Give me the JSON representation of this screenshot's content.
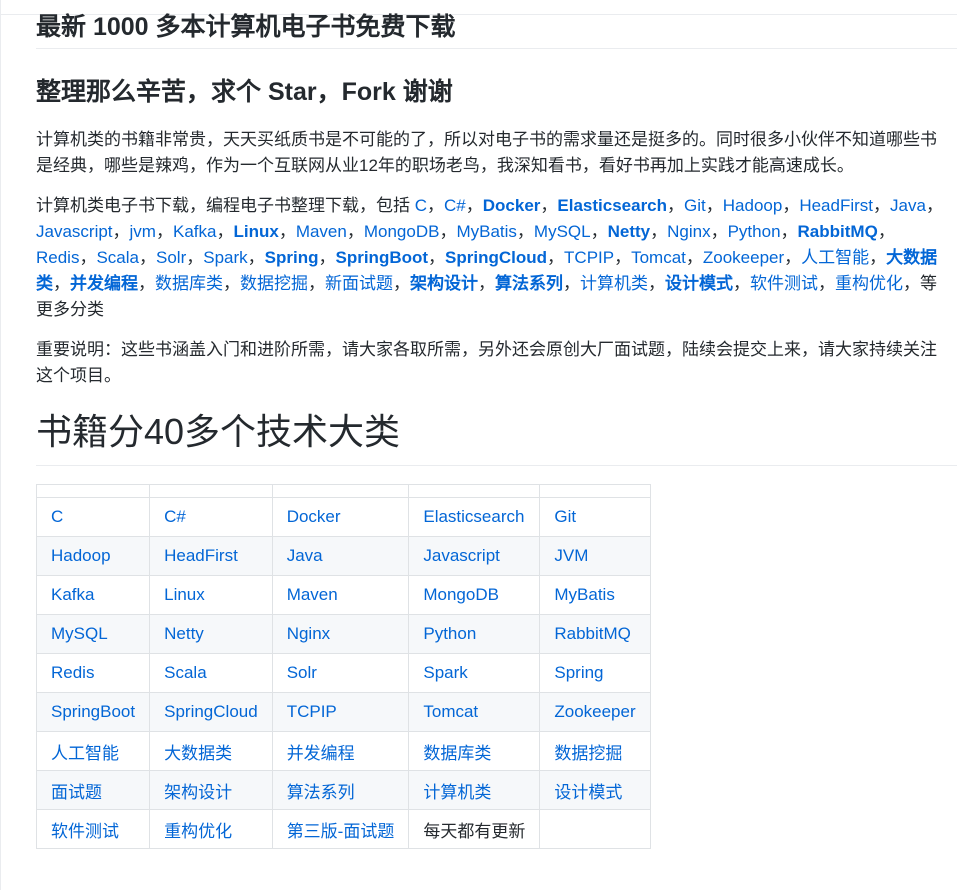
{
  "heading_main": "最新 1000 多本计算机电子书免费下载",
  "heading_sub": "整理那么辛苦，求个 Star，Fork 谢谢",
  "intro": "计算机类的书籍非常贵，天天买纸质书是不可能的了，所以对电子书的需求量还是挺多的。同时很多小伙伴不知道哪些书是经典，哪些是辣鸡，作为一个互联网从业12年的职场老鸟，我深知看书，看好书再加上实践才能高速成长。",
  "download_prefix": "计算机类电子书下载，编程电子书整理下载，包括 ",
  "download_suffix": "等更多分类",
  "download_links": [
    {
      "label": "C",
      "bold": false
    },
    {
      "label": "C#",
      "bold": false
    },
    {
      "label": "Docker",
      "bold": true
    },
    {
      "label": "Elasticsearch",
      "bold": true
    },
    {
      "label": "Git",
      "bold": false
    },
    {
      "label": "Hadoop",
      "bold": false
    },
    {
      "label": "HeadFirst",
      "bold": false
    },
    {
      "label": "Java",
      "bold": false
    },
    {
      "label": "Javascript",
      "bold": false
    },
    {
      "label": "jvm",
      "bold": false
    },
    {
      "label": "Kafka",
      "bold": false
    },
    {
      "label": "Linux",
      "bold": true
    },
    {
      "label": "Maven",
      "bold": false
    },
    {
      "label": "MongoDB",
      "bold": false
    },
    {
      "label": "MyBatis",
      "bold": false
    },
    {
      "label": "MySQL",
      "bold": false
    },
    {
      "label": "Netty",
      "bold": true
    },
    {
      "label": "Nginx",
      "bold": false
    },
    {
      "label": "Python",
      "bold": false
    },
    {
      "label": "RabbitMQ",
      "bold": true
    },
    {
      "label": "Redis",
      "bold": false
    },
    {
      "label": "Scala",
      "bold": false
    },
    {
      "label": "Solr",
      "bold": false
    },
    {
      "label": "Spark",
      "bold": false
    },
    {
      "label": "Spring",
      "bold": true
    },
    {
      "label": "SpringBoot",
      "bold": true
    },
    {
      "label": "SpringCloud",
      "bold": true
    },
    {
      "label": "TCPIP",
      "bold": false
    },
    {
      "label": "Tomcat",
      "bold": false
    },
    {
      "label": "Zookeeper",
      "bold": false
    },
    {
      "label": "人工智能",
      "bold": false
    },
    {
      "label": "大数据类",
      "bold": true
    },
    {
      "label": "并发编程",
      "bold": true
    },
    {
      "label": "数据库类",
      "bold": false
    },
    {
      "label": "数据挖掘",
      "bold": false
    },
    {
      "label": "新面试题",
      "bold": false
    },
    {
      "label": "架构设计",
      "bold": true
    },
    {
      "label": "算法系列",
      "bold": true
    },
    {
      "label": "计算机类",
      "bold": false
    },
    {
      "label": "设计模式",
      "bold": true
    },
    {
      "label": "软件测试",
      "bold": false
    },
    {
      "label": "重构优化",
      "bold": false
    }
  ],
  "important_note": "重要说明：这些书涵盖入门和进阶所需，请大家各取所需，另外还会原创大厂面试题，陆续会提交上来，请大家持续关注这个项目。",
  "heading_categories": "书籍分40多个技术大类",
  "category_table": [
    [
      "C",
      "C#",
      "Docker",
      "Elasticsearch",
      "Git"
    ],
    [
      "Hadoop",
      "HeadFirst",
      "Java",
      "Javascript",
      "JVM"
    ],
    [
      "Kafka",
      "Linux",
      "Maven",
      "MongoDB",
      "MyBatis"
    ],
    [
      "MySQL",
      "Netty",
      "Nginx",
      "Python",
      "RabbitMQ"
    ],
    [
      "Redis",
      "Scala",
      "Solr",
      "Spark",
      "Spring"
    ],
    [
      "SpringBoot",
      "SpringCloud",
      "TCPIP",
      "Tomcat",
      "Zookeeper"
    ],
    [
      "人工智能",
      "大数据类",
      "并发编程",
      "数据库类",
      "数据挖掘"
    ],
    [
      "面试题",
      "架构设计",
      "算法系列",
      "计算机类",
      "设计模式"
    ],
    [
      "软件测试",
      "重构优化",
      "第三版-面试题",
      "每天都有更新",
      ""
    ]
  ],
  "plain_cells": [
    "每天都有更新"
  ]
}
